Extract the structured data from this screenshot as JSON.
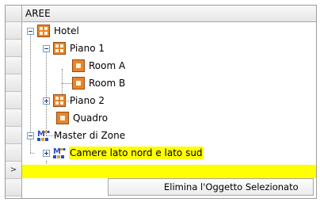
{
  "tree": {
    "column_header": "AREE",
    "current_row_marker": ">",
    "nodes": [
      {
        "label": "Hotel",
        "icon": "area-grid-icon"
      },
      {
        "label": "Piano 1",
        "icon": "area-grid-icon"
      },
      {
        "label": "Room A",
        "icon": "room-icon"
      },
      {
        "label": "Room B",
        "icon": "room-icon"
      },
      {
        "label": "Piano 2",
        "icon": "area-grid-icon"
      },
      {
        "label": "Quadro",
        "icon": "room-icon"
      },
      {
        "label": "Master di Zone",
        "icon": "master-zone-icon"
      },
      {
        "label": "Camere lato nord e lato sud",
        "icon": "master-zone-icon"
      }
    ]
  },
  "context_menu": {
    "items": [
      {
        "label": "Elimina l'Oggetto Selezionato"
      }
    ]
  },
  "colors": {
    "selection": "#ffff00",
    "area_icon": "#e07a1a",
    "master_icon_blue": "#2a4bc7"
  }
}
